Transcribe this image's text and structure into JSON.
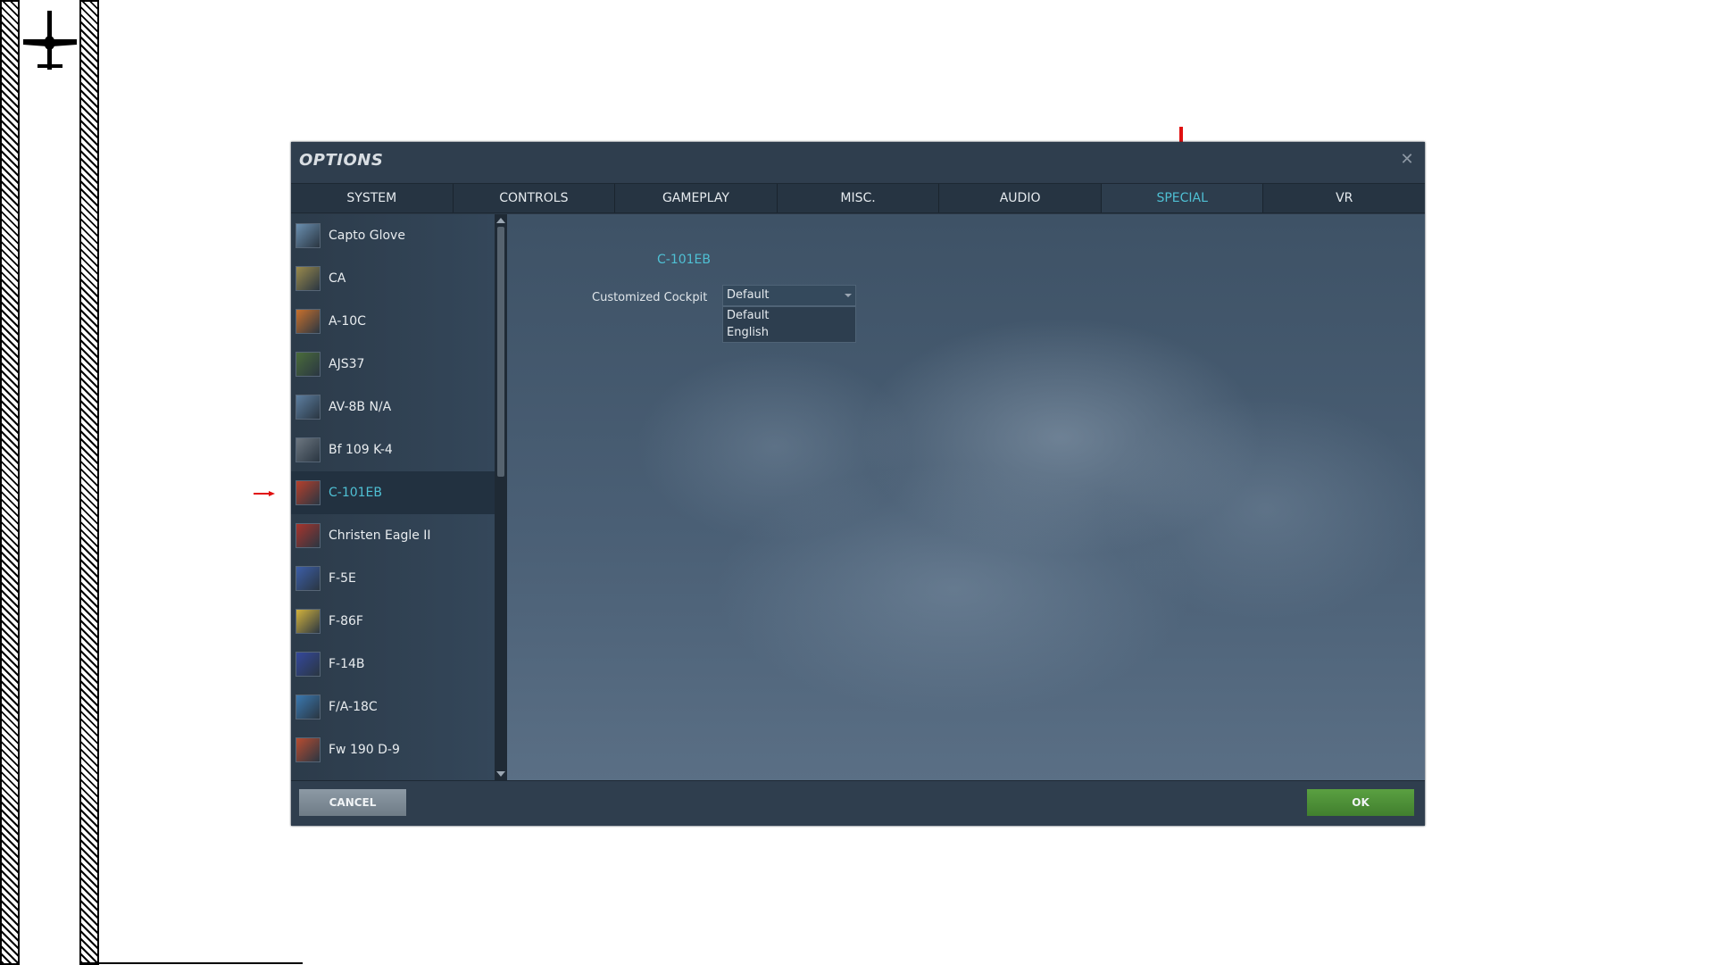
{
  "dialog": {
    "title": "OPTIONS",
    "close_icon": "close-icon"
  },
  "tabs": [
    {
      "label": "SYSTEM",
      "active": false
    },
    {
      "label": "CONTROLS",
      "active": false
    },
    {
      "label": "GAMEPLAY",
      "active": false
    },
    {
      "label": "MISC.",
      "active": false
    },
    {
      "label": "AUDIO",
      "active": false
    },
    {
      "label": "SPECIAL",
      "active": true
    },
    {
      "label": "VR",
      "active": false
    }
  ],
  "sidebar": {
    "items": [
      {
        "label": "Capto Glove",
        "icon": "capto-glove-icon",
        "color": "#6a8fb0"
      },
      {
        "label": "CA",
        "icon": "ca-icon",
        "color": "#9a8a4c"
      },
      {
        "label": "A-10C",
        "icon": "a10c-icon",
        "color": "#c8702c"
      },
      {
        "label": "AJS37",
        "icon": "ajs37-icon",
        "color": "#4a6c3a"
      },
      {
        "label": "AV-8B N/A",
        "icon": "av8b-icon",
        "color": "#5c7ea0"
      },
      {
        "label": "Bf 109 K-4",
        "icon": "bf109-icon",
        "color": "#6c7680"
      },
      {
        "label": "C-101EB",
        "icon": "c101eb-icon",
        "color": "#b6402c",
        "selected": true
      },
      {
        "label": "Christen Eagle II",
        "icon": "christen-eagle-icon",
        "color": "#a8342c"
      },
      {
        "label": "F-5E",
        "icon": "f5e-icon",
        "color": "#3c5ea8"
      },
      {
        "label": "F-86F",
        "icon": "f86f-icon",
        "color": "#d2b23c"
      },
      {
        "label": "F-14B",
        "icon": "f14b-icon",
        "color": "#34489c"
      },
      {
        "label": "F/A-18C",
        "icon": "fa18c-icon",
        "color": "#3a78b0"
      },
      {
        "label": "Fw 190 D-9",
        "icon": "fw190-icon",
        "color": "#b84c30"
      }
    ]
  },
  "content": {
    "section_title": "C-101EB",
    "customized_cockpit_label": "Customized Cockpit",
    "select_value": "Default",
    "dropdown_options": [
      "Default",
      "English"
    ]
  },
  "footer": {
    "cancel_label": "CANCEL",
    "ok_label": "OK"
  },
  "colors": {
    "accent": "#4fc0d4",
    "ok_green": "#4a8f36",
    "annotation_red": "#e01010"
  }
}
